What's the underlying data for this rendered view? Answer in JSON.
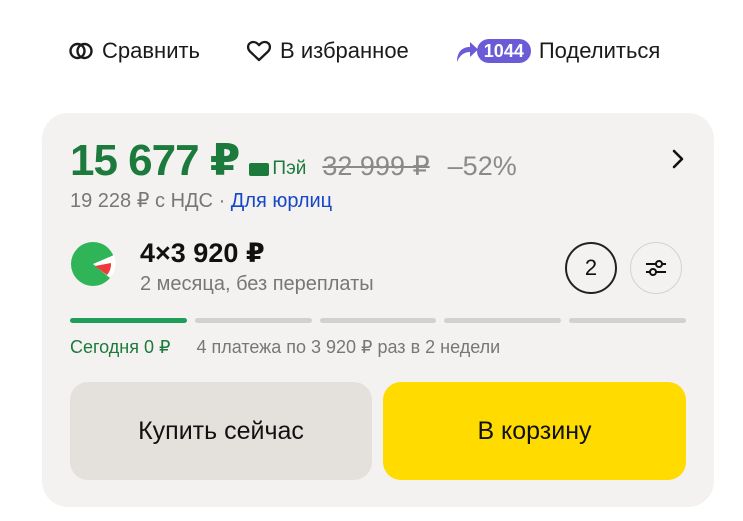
{
  "actions": {
    "compare_label": "Сравнить",
    "favorite_label": "В избранное",
    "share_count": "1044",
    "share_label": "Поделиться"
  },
  "offer": {
    "price": "15 677 ₽",
    "pay_label": "Пэй",
    "old_price": "32 999 ₽",
    "discount": "–52%",
    "vat_text": "19 228 ₽ с НДС",
    "vat_separator": "·",
    "legal_link": "Для юрлиц"
  },
  "split": {
    "title": "4×3 920 ₽",
    "subtitle": "2 месяца, без переплаты",
    "months_button": "2",
    "progress_segments": 5,
    "progress_active": 1,
    "today_label": "Сегодня 0 ₽",
    "schedule": "4 платежа по 3 920 ₽ раз в 2 недели"
  },
  "buttons": {
    "buy_now": "Купить сейчас",
    "add_to_cart": "В корзину"
  },
  "colors": {
    "price_green": "#1c7a3c",
    "link_blue": "#1747c7",
    "share_badge": "#6b5bd6",
    "cart_yellow": "#ffdb00",
    "card_bg": "#f3f2f1"
  }
}
